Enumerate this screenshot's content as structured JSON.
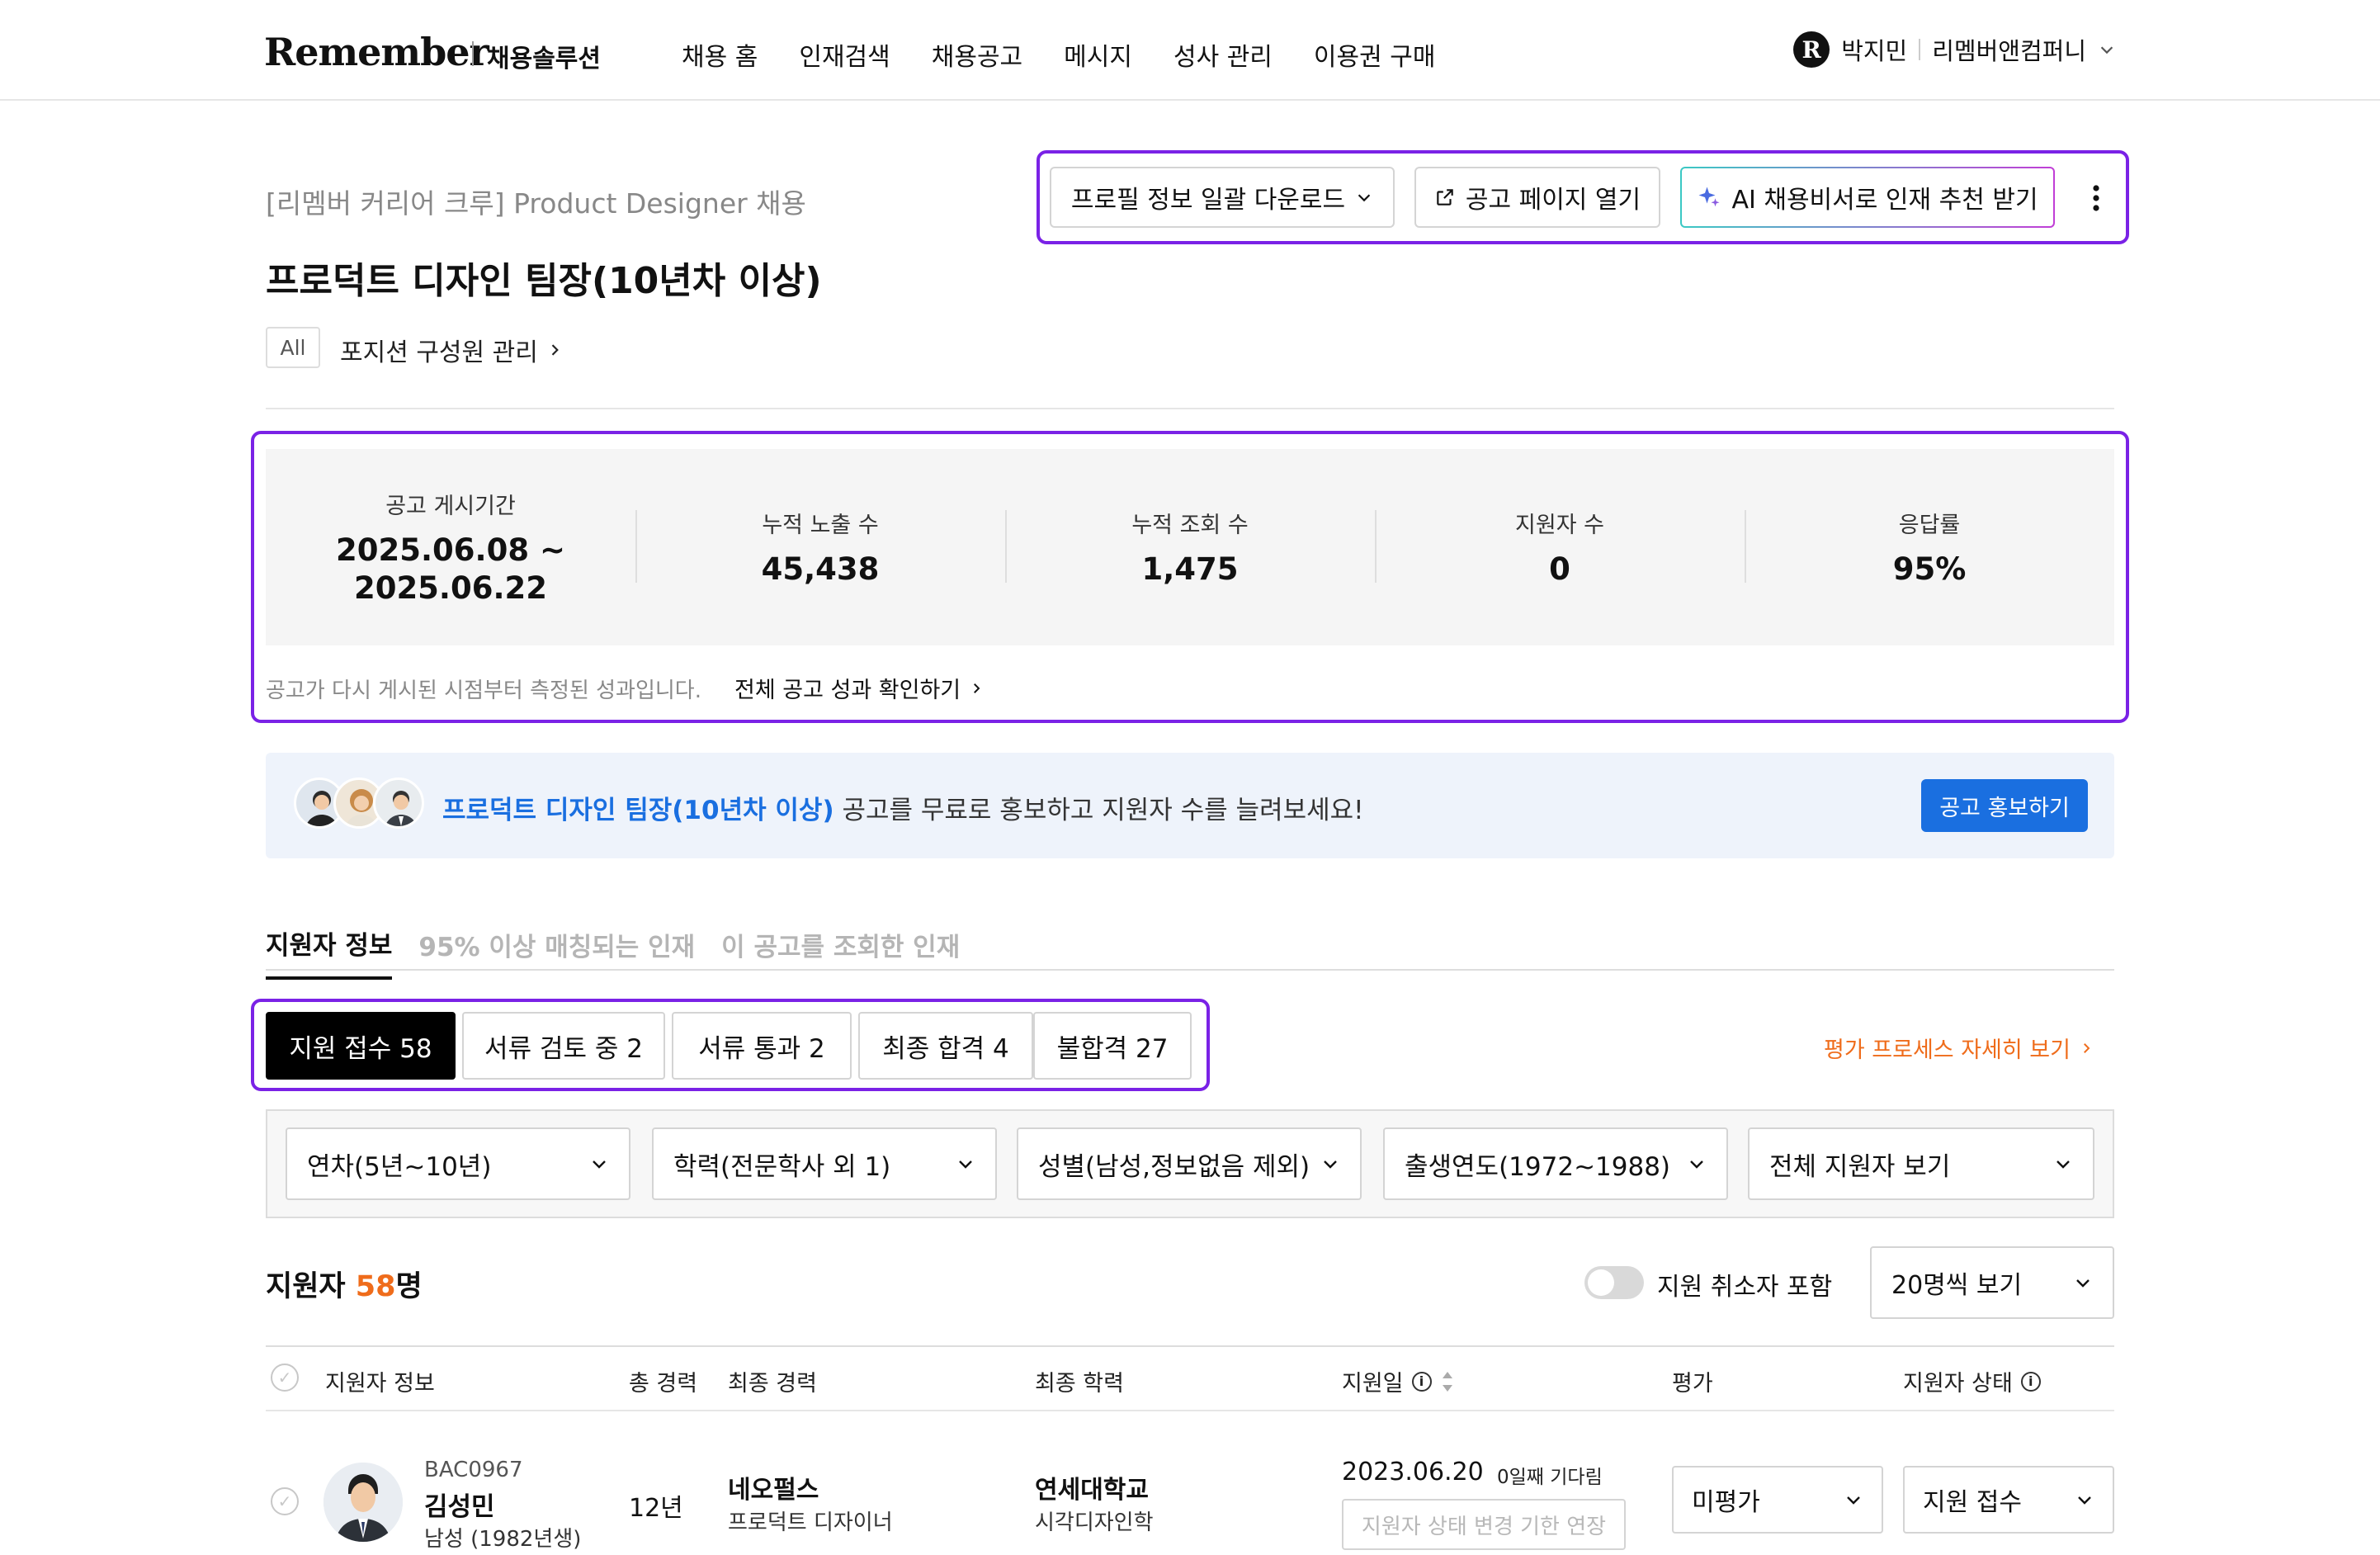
{
  "header": {
    "logo": "Remember",
    "logo_sub": "채용솔루션",
    "nav": [
      "채용 홈",
      "인재검색",
      "채용공고",
      "메시지",
      "성사 관리",
      "이용권 구매"
    ],
    "user_name": "박지민",
    "company": "리멤버앤컴퍼니"
  },
  "job": {
    "subtitle": "[리멤버 커리어 크루] Product Designer 채용",
    "title": "프로덕트 디자인 팀장(10년차 이상)",
    "badge": "All",
    "member_link": "포지션 구성원 관리"
  },
  "actions": {
    "download": "프로필 정보 일괄 다운로드",
    "open_page": "공고 페이지 열기",
    "ai": "AI 채용비서로 인재 추천 받기"
  },
  "stats": {
    "items": [
      {
        "label": "공고 게시기간",
        "value": "2025.06.08 ~\n2025.06.22"
      },
      {
        "label": "누적 노출 수",
        "value": "45,438"
      },
      {
        "label": "누적 조회 수",
        "value": "1,475"
      },
      {
        "label": "지원자 수",
        "value": "0"
      },
      {
        "label": "응답률",
        "value": "95%"
      }
    ],
    "note": "공고가 다시 게시된 시점부터 측정된 성과입니다.",
    "link": "전체 공고 성과 확인하기"
  },
  "promo": {
    "highlight": "프로덕트 디자인 팀장(10년차 이상)",
    "text": " 공고를 무료로 홍보하고 지원자 수를 늘려보세요!",
    "button": "공고 홍보하기"
  },
  "tabs": [
    "지원자 정보",
    "95% 이상 매칭되는 인재",
    "이 공고를 조회한 인재"
  ],
  "status_filters": [
    {
      "label": "지원 접수 58",
      "active": true
    },
    {
      "label": "서류 검토 중 2",
      "active": false
    },
    {
      "label": "서류 통과 2",
      "active": false
    },
    {
      "label": "최종 합격 4",
      "active": false
    },
    {
      "label": "불합격 27",
      "active": false
    }
  ],
  "eval_link": "평가 프로세스 자세히 보기",
  "filters": [
    "연차(5년~10년)",
    "학력(전문학사 외 1)",
    "성별(남성,정보없음 제외)",
    "출생연도(1972~1988)",
    "전체 지원자 보기"
  ],
  "applicants": {
    "label": "지원자 ",
    "count": "58",
    "unit": "명",
    "toggle_label": "지원 취소자 포함",
    "per_page": "20명씩 보기"
  },
  "table": {
    "headers": [
      "지원자 정보",
      "총 경력",
      "최종 경력",
      "최종 학력",
      "지원일",
      "평가",
      "지원자 상태"
    ],
    "rows": [
      {
        "code": "BAC0967",
        "name": "김성민",
        "gender_birth": "남성 (1982년생)",
        "career_years": "12년",
        "last_company": "네오펄스",
        "last_role": "프로덕트 디자이너",
        "school": "연세대학교",
        "major": "시각디자인학",
        "applied": "2023.06.20",
        "waiting": "0일째 기다림",
        "extend_button": "지원자 상태 변경 기한 연장",
        "evaluation": "미평가",
        "status": "지원 접수"
      }
    ]
  }
}
